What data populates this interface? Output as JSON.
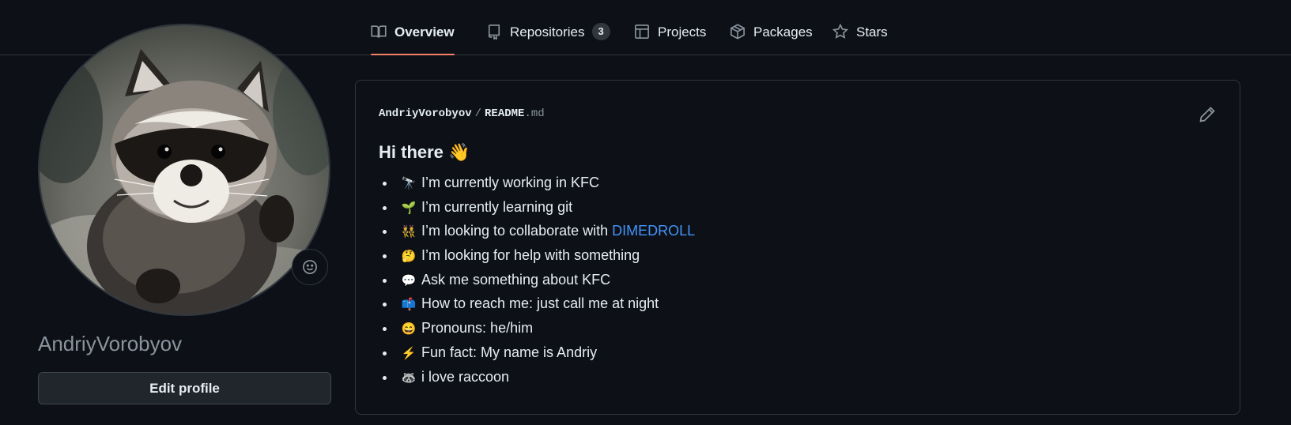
{
  "nav": {
    "tabs": [
      {
        "label": "Overview",
        "icon": "book-icon",
        "active": true
      },
      {
        "label": "Repositories",
        "icon": "repo-icon",
        "count": "3"
      },
      {
        "label": "Projects",
        "icon": "table-icon"
      },
      {
        "label": "Packages",
        "icon": "package-icon"
      },
      {
        "label": "Stars",
        "icon": "star-icon"
      }
    ]
  },
  "profile": {
    "avatar_alt": "raccoon avatar",
    "username": "AndriyVorobyov",
    "edit_button": "Edit profile"
  },
  "readme": {
    "owner": "AndriyVorobyov",
    "separator": "/",
    "file": "README",
    "ext": ".md",
    "heading": "Hi there 👋",
    "items": [
      {
        "emoji": "🔭",
        "text": "I’m currently working in KFC"
      },
      {
        "emoji": "🌱",
        "text": "I’m currently learning git"
      },
      {
        "emoji": "👯",
        "text": "I’m looking to collaborate with ",
        "link": "DIMEDROLL"
      },
      {
        "emoji": "🤔",
        "text": "I’m looking for help with something"
      },
      {
        "emoji": "💬",
        "text": "Ask me something about KFC"
      },
      {
        "emoji": "📫",
        "text": "How to reach me: just call me at night"
      },
      {
        "emoji": "😄",
        "text": "Pronouns: he/him"
      },
      {
        "emoji": "⚡",
        "text": "Fun fact: My name is Andriy"
      },
      {
        "emoji": "🦝",
        "text": "i love raccoon"
      }
    ]
  },
  "colors": {
    "background": "#0d1117",
    "border": "#30363d",
    "active_tab_underline": "#f78166",
    "link": "#4493f8",
    "muted": "#8b949e"
  }
}
